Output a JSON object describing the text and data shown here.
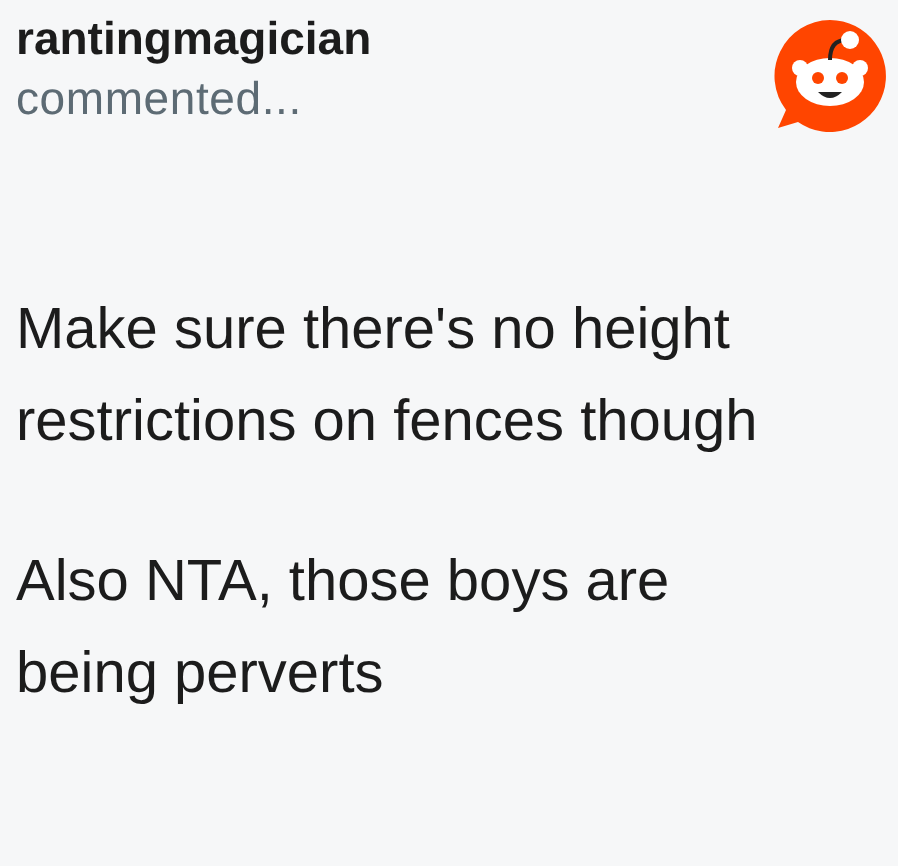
{
  "comment": {
    "author": "rantingmagician",
    "action": "commented...",
    "paragraphs": [
      "Make sure there's no height restrictions on fences though",
      "Also NTA, those boys are being perverts"
    ]
  }
}
